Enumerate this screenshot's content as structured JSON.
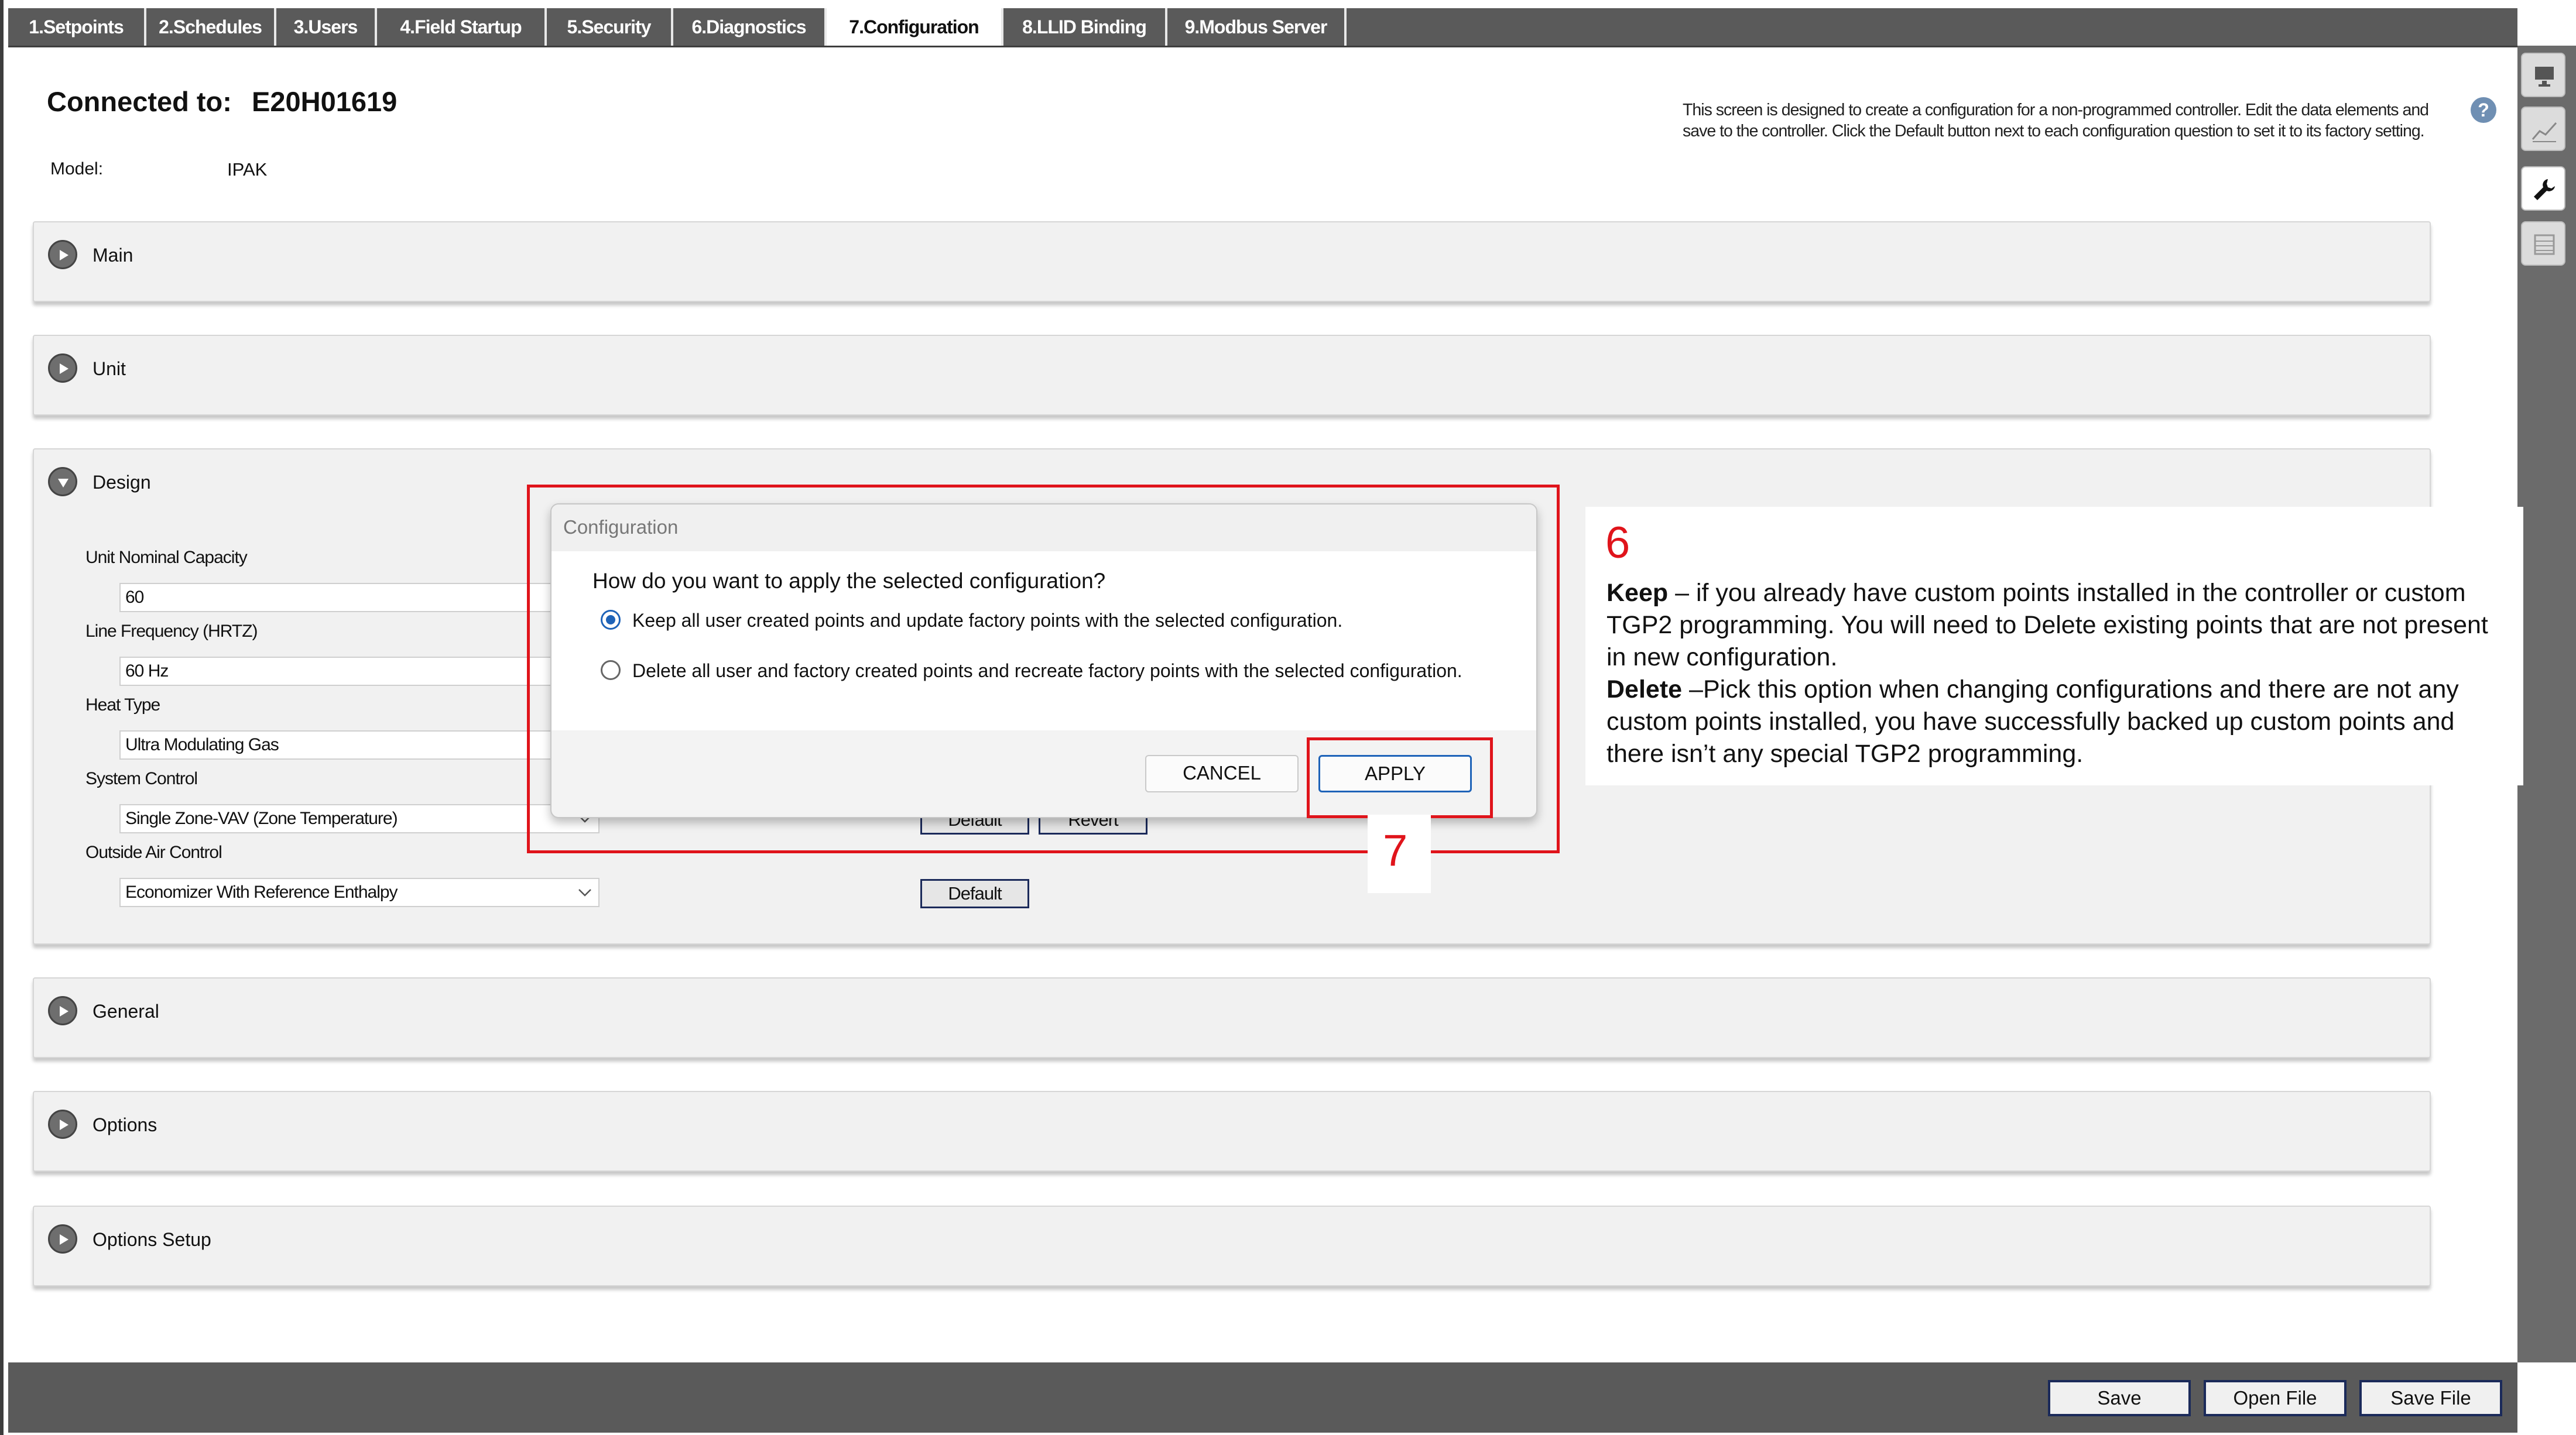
{
  "tabs": [
    {
      "label": "1.Setpoints"
    },
    {
      "label": "2.Schedules"
    },
    {
      "label": "3.Users"
    },
    {
      "label": "4.Field Startup"
    },
    {
      "label": "5.Security"
    },
    {
      "label": "6.Diagnostics"
    },
    {
      "label": "7.Configuration",
      "active": true
    },
    {
      "label": "8.LLID Binding"
    },
    {
      "label": "9.Modbus Server"
    }
  ],
  "header": {
    "connected_label": "Connected to:",
    "connected_value": "E20H01619",
    "model_label": "Model:",
    "model_value": "IPAK",
    "help_text": "This screen is designed to create a configuration for a non-programmed controller. Edit the data elements and save to the controller. Click the Default button next to each configuration question to set it to its factory setting.",
    "help_icon": "?"
  },
  "sidebar_icons": [
    "monitor-icon",
    "trend-chart-icon",
    "wrench-icon",
    "layers-icon"
  ],
  "panels": {
    "main": "Main",
    "unit": "Unit",
    "design": "Design",
    "general": "General",
    "options": "Options",
    "options_setup": "Options Setup"
  },
  "design": {
    "fields": [
      {
        "label": "Unit Nominal Capacity",
        "value": "60"
      },
      {
        "label": "Line Frequency (HRTZ)",
        "value": "60 Hz"
      },
      {
        "label": "Heat Type",
        "value": "Ultra Modulating Gas"
      },
      {
        "label": "System Control",
        "value": "Single Zone-VAV (Zone Temperature)"
      },
      {
        "label": "Outside Air Control",
        "value": "Economizer With Reference Enthalpy"
      }
    ],
    "default_label": "Default",
    "revert_label": "Revert"
  },
  "dialog": {
    "title": "Configuration",
    "question": "How do you want to apply the selected configuration?",
    "options": [
      {
        "label": "Keep all user created points and update factory points with the selected configuration.",
        "checked": true
      },
      {
        "label": "Delete all user and factory created points and recreate factory points with the selected configuration.",
        "checked": false
      }
    ],
    "cancel_label": "CANCEL",
    "apply_label": "APPLY"
  },
  "callouts": {
    "step6": "6",
    "step6_keep_title": "Keep",
    "step6_keep_text": " – if you already have custom points installed in the controller or custom TGP2 programming.   You will need to Delete existing points that are not present in new configuration.",
    "step6_delete_title": "Delete",
    "step6_delete_text": " –Pick this option when changing configurations and there are not any custom points installed, you have successfully backed up custom points and there isn’t any special TGP2 programming.",
    "step7": "7"
  },
  "footer": {
    "save_label": "Save",
    "open_label": "Open File",
    "save_file_label": "Save File"
  },
  "colors": {
    "annotation_red": "#e0141b",
    "radio_blue": "#1e63b8",
    "tabbar_gray": "#5a5a5a"
  }
}
